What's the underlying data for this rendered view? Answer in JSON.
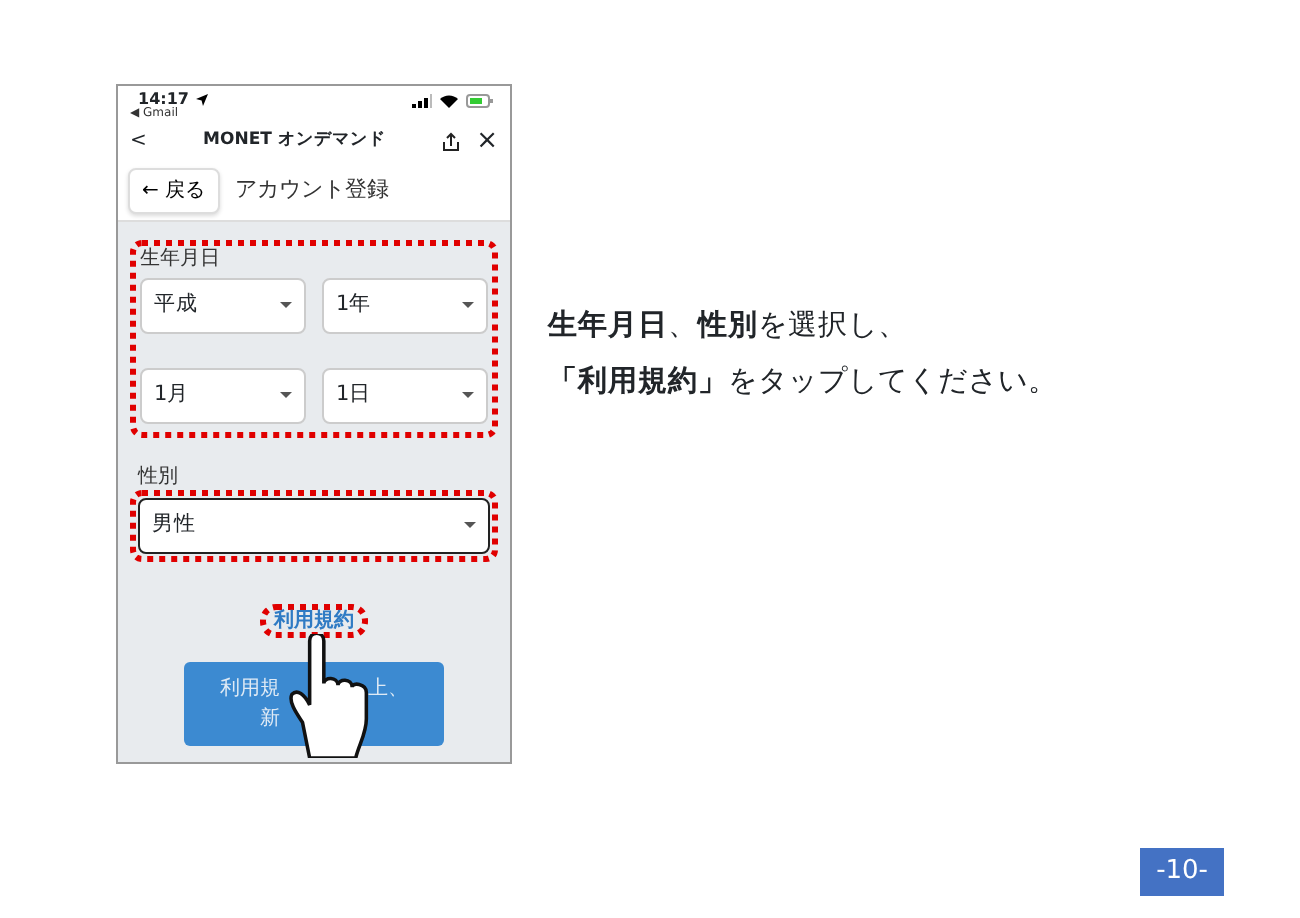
{
  "phone": {
    "status_time": "14:17",
    "back_app": "◀ Gmail",
    "nav": {
      "back": "<",
      "title": "MONET オンデマンド",
      "close": "×"
    },
    "header": {
      "back_button": "← 戻る",
      "title": "アカウント登録"
    },
    "form": {
      "birth_label": "生年月日",
      "birth_selects": [
        {
          "value": "平成"
        },
        {
          "value": "1年"
        },
        {
          "value": "1月"
        },
        {
          "value": "1日"
        }
      ],
      "gender_label": "性別",
      "gender_select": {
        "value": "男性"
      },
      "terms_link": "利用規約",
      "submit_button": {
        "line_1": [
          "利用規",
          "上、"
        ],
        "line_2": [
          "新"
        ]
      }
    }
  },
  "instruction": [
    "**生年月日**、**性別**を選択し、",
    "**「利用規約」**をタップしてください。"
  ],
  "page_number": "-10-"
}
